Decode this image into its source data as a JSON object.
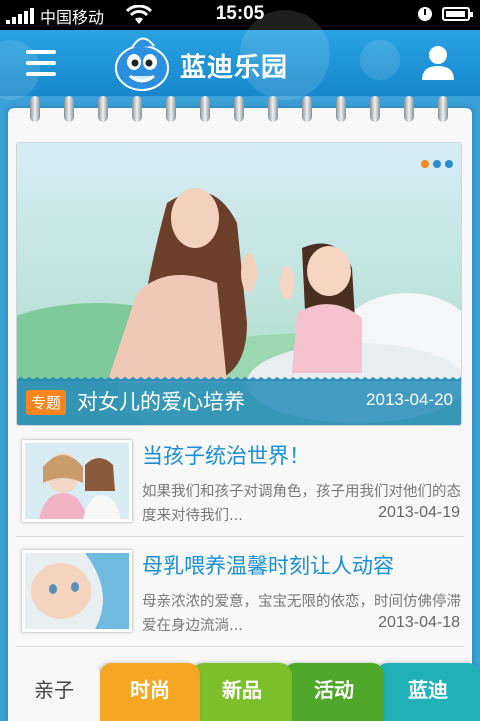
{
  "status_bar": {
    "carrier": "中国移动",
    "time": "15:05"
  },
  "header": {
    "title": "蓝迪乐园",
    "menu_icon": "hamburger-icon",
    "user_icon": "user-icon",
    "logo": "blue-mascot-logo"
  },
  "featured": {
    "tag": "专题",
    "title": "对女儿的爱心培养",
    "date": "2013-04-20",
    "carousel_dots": [
      "#f4851f",
      "#2a8cc8",
      "#2a8cc8"
    ]
  },
  "articles": [
    {
      "title": "当孩子统治世界！",
      "description": "如果我们和孩子对调角色，孩子用我们对他们的态度来对待我们...",
      "date": "2013-04-19"
    },
    {
      "title": "母乳喂养温馨时刻让人动容",
      "description": "母亲浓浓的爱意，宝宝无限的依恋，时间仿佛停滞爱在身边流淌...",
      "date": "2013-04-18"
    }
  ],
  "tabs": [
    {
      "label": "亲子",
      "color": "#f7f8f7",
      "active": true
    },
    {
      "label": "时尚",
      "color": "#f5a623",
      "active": false
    },
    {
      "label": "新品",
      "color": "#7cbf2a",
      "active": false
    },
    {
      "label": "活动",
      "color": "#4fa82a",
      "active": false
    },
    {
      "label": "蓝迪",
      "color": "#1fb0b8",
      "active": false
    }
  ],
  "colors": {
    "accent": "#1a8fd3",
    "header": "#2196d8"
  }
}
